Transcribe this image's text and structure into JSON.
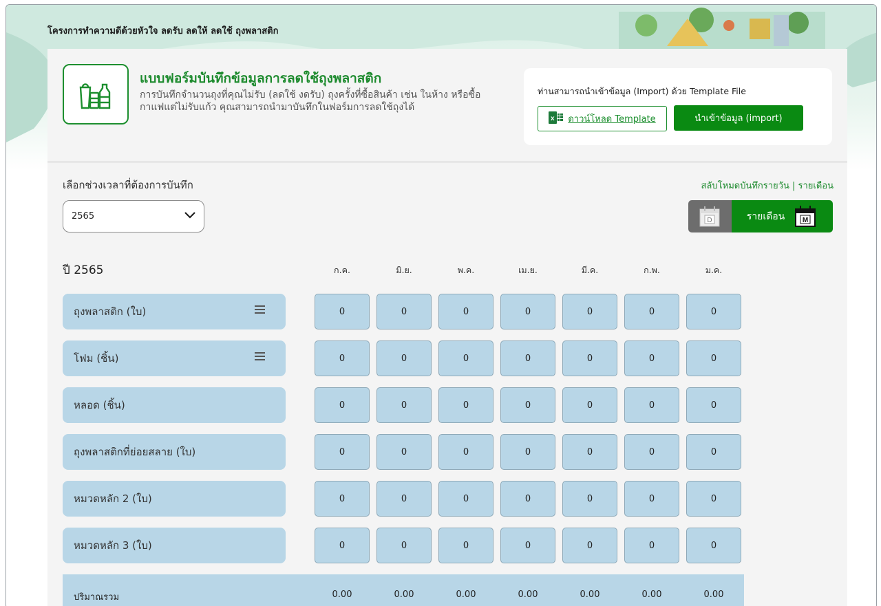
{
  "site_title": "โครงการทำความดีด้วยหัวใจ ลดรับ ลดให้ ลดใช้ ถุงพลาสติก",
  "form": {
    "title": "แบบฟอร์มบันทึกข้อมูลการลดใช้ถุงพลาสติก",
    "desc_line1": "การบันทึกจำนวนถุงที่คุณไม่รับ (ลดใช้ งดรับ) ถุงครั้งที่ซื้อสินค้า เช่น ในห้าง หรือซื้อ",
    "desc_line2": "กาแฟแต่ไม่รับแก้ว คุณสามารถนำมาบันทึกในฟอร์มการลดใช้ถุงได้",
    "icon": "plastic-products-icon"
  },
  "import": {
    "text": "ท่านสามารถนำเข้าข้อมูล (Import) ด้วย Template File",
    "download_label": "ดาวน์โหลด Template",
    "import_label": "นำเข้าข้อมูล (import)"
  },
  "period": {
    "label": "เลือกช่วงเวลาที่ต้องการบันทึก",
    "selected_year": "2565"
  },
  "mode": {
    "switch_link": "สลับโหมดบันทึกรายวัน | รายเดือน",
    "daily_letter": "D",
    "monthly_label": "รายเดือน",
    "monthly_letter": "M"
  },
  "table": {
    "year_heading": "ปี 2565",
    "months": [
      "ก.ค.",
      "มิ.ย.",
      "พ.ค.",
      "เม.ย.",
      "มี.ค.",
      "ก.พ.",
      "ม.ค."
    ],
    "rows": [
      {
        "label": "ถุงพลาสติก (ใบ)",
        "values": [
          "0",
          "0",
          "0",
          "0",
          "0",
          "0",
          "0"
        ]
      },
      {
        "label": "โฟม (ชิ้น)",
        "values": [
          "0",
          "0",
          "0",
          "0",
          "0",
          "0",
          "0"
        ]
      },
      {
        "label": "หลอด (ชิ้น)",
        "values": [
          "0",
          "0",
          "0",
          "0",
          "0",
          "0",
          "0"
        ]
      },
      {
        "label": "ถุงพลาสติกที่ย่อยสลาย (ใบ)",
        "values": [
          "0",
          "0",
          "0",
          "0",
          "0",
          "0",
          "0"
        ]
      },
      {
        "label": "หมวดหลัก 2 (ใบ)",
        "values": [
          "0",
          "0",
          "0",
          "0",
          "0",
          "0",
          "0"
        ]
      },
      {
        "label": "หมวดหลัก 3 (ใบ)",
        "values": [
          "0",
          "0",
          "0",
          "0",
          "0",
          "0",
          "0"
        ]
      }
    ],
    "total_label": "ปริมาณรวม",
    "totals": [
      "0.00",
      "0.00",
      "0.00",
      "0.00",
      "0.00",
      "0.00",
      "0.00"
    ]
  },
  "colors": {
    "brand_green": "#0a8a12",
    "cell_blue": "#b8d6e7"
  }
}
